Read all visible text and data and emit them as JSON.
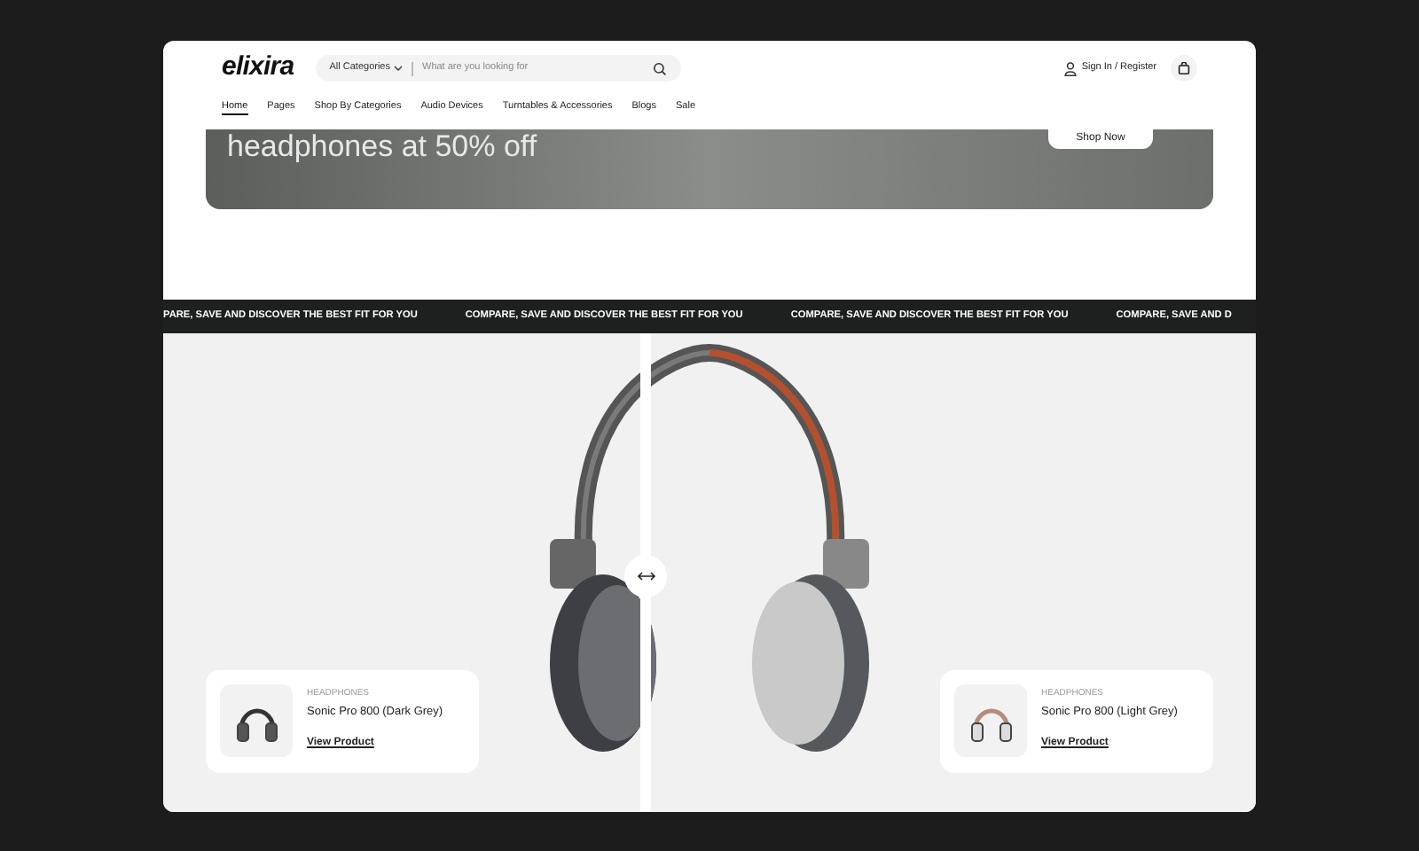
{
  "header": {
    "logo": "elixira",
    "category_select": "All Categories",
    "search": {
      "placeholder": "What are you looking for"
    },
    "account_link": "Sign In / Register"
  },
  "nav": [
    {
      "label": "Home",
      "selected": true
    },
    {
      "label": "Pages",
      "selected": false
    },
    {
      "label": "Shop By Categories",
      "selected": false
    },
    {
      "label": "Audio Devices",
      "selected": false
    },
    {
      "label": "Turntables & Accessories",
      "selected": false
    },
    {
      "label": "Blogs",
      "selected": false
    },
    {
      "label": "Sale",
      "selected": false
    }
  ],
  "banner": {
    "headline": "headphones at 50% off",
    "button": "Shop Now"
  },
  "marquee": [
    "PARE, SAVE AND DISCOVER THE BEST FIT FOR YOU",
    "COMPARE, SAVE AND DISCOVER THE BEST FIT FOR YOU",
    "COMPARE, SAVE AND DISCOVER THE BEST FIT FOR YOU",
    "COMPARE, SAVE AND D"
  ],
  "compare": {
    "products": [
      {
        "category": "HEADPHONES",
        "name": "Sonic Pro 800 (Dark Grey)",
        "link": "View Product",
        "kind": "dark"
      },
      {
        "category": "HEADPHONES",
        "name": "Sonic Pro 800 (Light Grey)",
        "link": "View Product",
        "kind": "light"
      }
    ]
  }
}
